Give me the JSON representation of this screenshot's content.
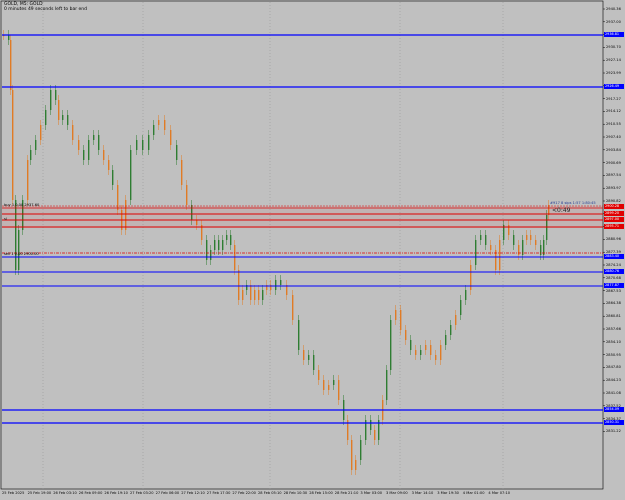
{
  "header": {
    "title": "GOLD, M5: GOLD",
    "subtitle": "0 minutes 49 seconds left to bar end"
  },
  "countdown": "<0:49",
  "order_label": "#917 8 sips 1:57 1:80:45",
  "level_labels": [
    {
      "text": "buy 1 0.00 2937.60"
    },
    {
      "text": "sl"
    },
    {
      "text": "sell 1 0.00 2900.00"
    }
  ],
  "colors": {
    "background": "#c0c0c0",
    "bull": "#2e7d32",
    "bear": "#e07b25",
    "support_line": "#0000ff",
    "resistance_line": "#e00000",
    "grid": "#9a9a9a"
  },
  "y_axis": {
    "ticks": [
      "2940.36",
      "2937.00",
      "2933.85",
      "2930.70",
      "2927.14",
      "2923.99",
      "2920.42",
      "2917.27",
      "2914.12",
      "2910.55",
      "2907.40",
      "2903.84",
      "2900.69",
      "2897.54",
      "2893.97",
      "2890.82",
      "2887.26",
      "2884.11",
      "2880.96",
      "2877.39",
      "2874.24",
      "2870.68",
      "2867.53",
      "2864.38",
      "2860.81",
      "2857.66",
      "2854.10",
      "2850.95",
      "2847.80",
      "2844.23",
      "2841.08",
      "2837.52",
      "2834.37",
      "2831.22"
    ]
  },
  "x_axis": {
    "ticks": [
      "25 Feb 2025",
      "25 Feb 19:00",
      "26 Feb 03:10",
      "26 Feb 09:00",
      "26 Feb 19:10",
      "27 Feb 03:20",
      "27 Feb 06:00",
      "27 Feb 12:10",
      "27 Feb 17:30",
      "27 Feb 22:00",
      "28 Feb 05:10",
      "28 Feb 10:30",
      "28 Feb 15:00",
      "28 Feb 21:10",
      "3 Mar 03:00",
      "3 Mar 09:00",
      "3 Mar 14:10",
      "3 Mar 19:30",
      "4 Mar 01:00",
      "4 Mar 07:10"
    ]
  },
  "price_boxes": [
    {
      "text": "2936.81",
      "color": "#0000ff"
    },
    {
      "text": "2926.49",
      "color": "#0000ff"
    },
    {
      "text": "2900.28",
      "color": "#e00000"
    },
    {
      "text": "2899.20",
      "color": "#e00000"
    },
    {
      "text": "2897.00",
      "color": "#e00000"
    },
    {
      "text": "2895.71",
      "color": "#e00000"
    },
    {
      "text": "2883.40",
      "color": "#0000ff"
    },
    {
      "text": "2880.76",
      "color": "#0000ff"
    },
    {
      "text": "2877.87",
      "color": "#0000ff"
    },
    {
      "text": "2854.09",
      "color": "#0000ff"
    },
    {
      "text": "2850.31",
      "color": "#0000ff"
    }
  ]
}
